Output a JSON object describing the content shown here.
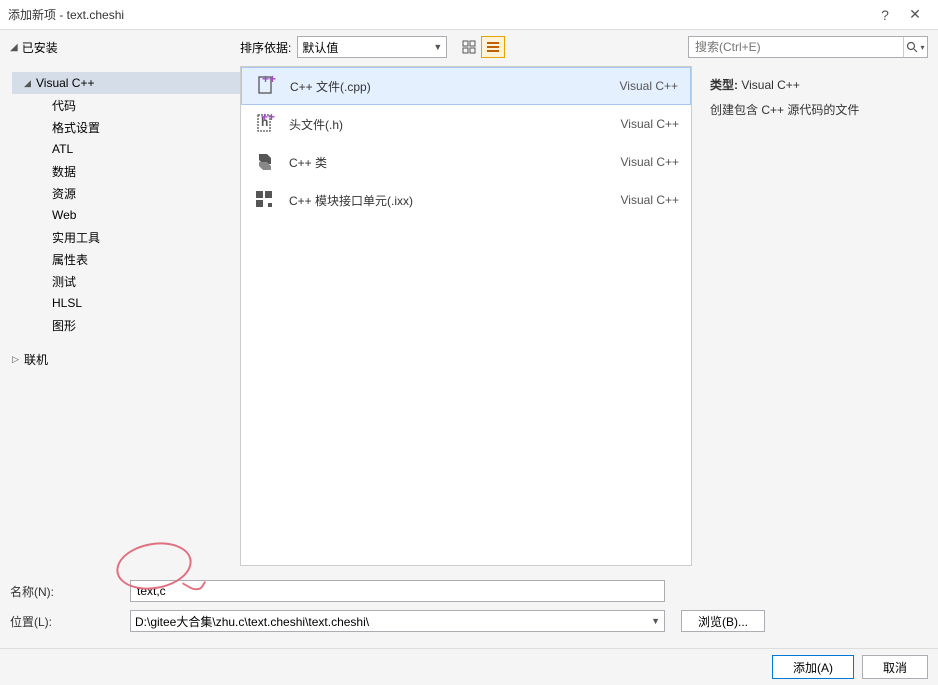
{
  "titlebar": {
    "title": "添加新项 - text.cheshi",
    "help": "?",
    "close": "✕"
  },
  "toolbar": {
    "installed_label": "已安装",
    "sort_label": "排序依据:",
    "sort_value": "默认值",
    "search_placeholder": "搜索(Ctrl+E)"
  },
  "tree": {
    "items": [
      {
        "label": "Visual C++",
        "level": 1,
        "arrow": true,
        "selected": true
      },
      {
        "label": "代码",
        "level": 2
      },
      {
        "label": "格式设置",
        "level": 2
      },
      {
        "label": "ATL",
        "level": 2
      },
      {
        "label": "数据",
        "level": 2
      },
      {
        "label": "资源",
        "level": 2
      },
      {
        "label": "Web",
        "level": 2
      },
      {
        "label": "实用工具",
        "level": 2
      },
      {
        "label": "属性表",
        "level": 2
      },
      {
        "label": "测试",
        "level": 2
      },
      {
        "label": "HLSL",
        "level": 2
      },
      {
        "label": "图形",
        "level": 2
      }
    ],
    "online_label": "联机"
  },
  "templates": [
    {
      "icon": "cpp-file",
      "name": "C++ 文件(.cpp)",
      "category": "Visual C++",
      "selected": true
    },
    {
      "icon": "h-file",
      "name": "头文件(.h)",
      "category": "Visual C++"
    },
    {
      "icon": "cpp-class",
      "name": "C++ 类",
      "category": "Visual C++"
    },
    {
      "icon": "module",
      "name": "C++ 模块接口单元(.ixx)",
      "category": "Visual C++"
    }
  ],
  "info": {
    "type_label": "类型:",
    "type_value": "Visual C++",
    "description": "创建包含 C++ 源代码的文件"
  },
  "fields": {
    "name_label": "名称(N):",
    "name_value": "text,c",
    "location_label": "位置(L):",
    "location_value": "D:\\gitee大合集\\zhu.c\\text.cheshi\\text.cheshi\\",
    "browse_label": "浏览(B)..."
  },
  "buttons": {
    "add": "添加(A)",
    "cancel": "取消"
  }
}
